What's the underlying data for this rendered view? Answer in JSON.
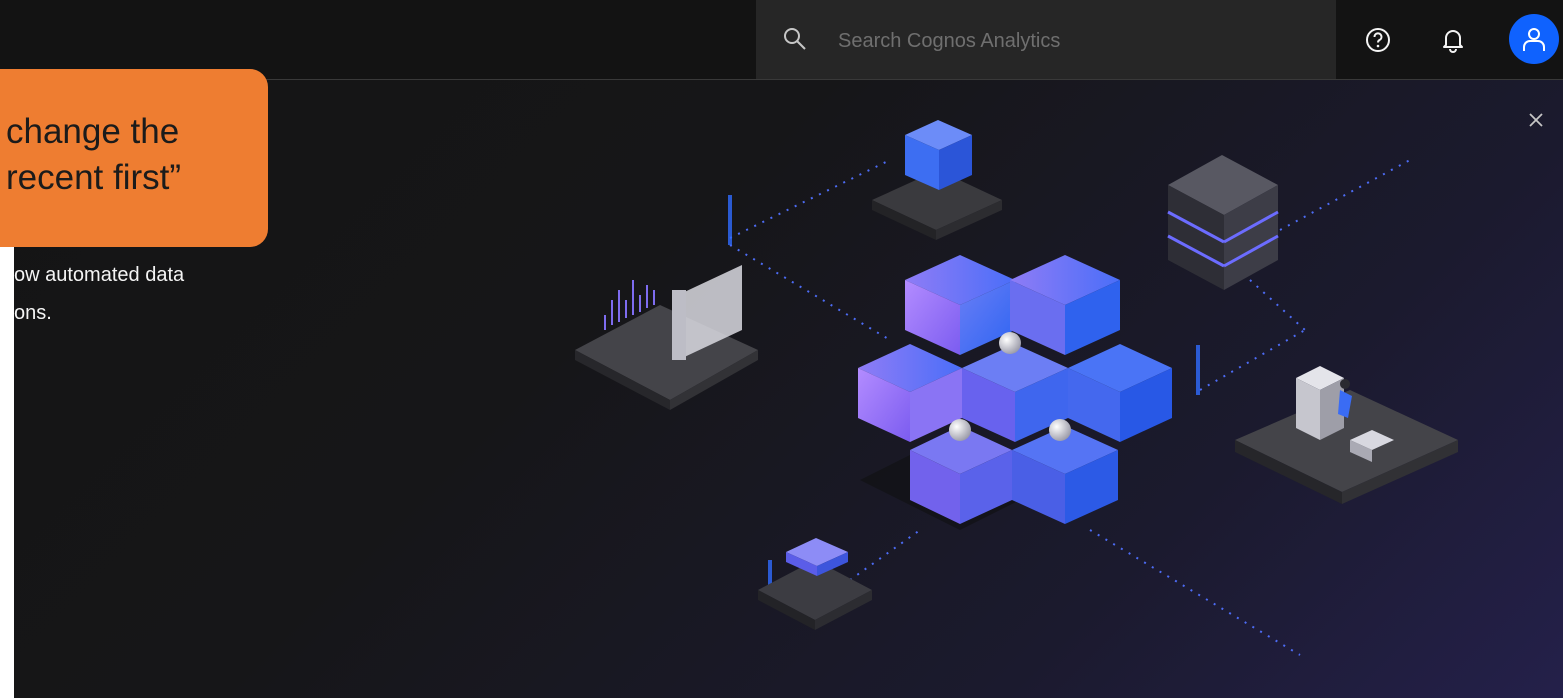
{
  "header": {
    "search": {
      "placeholder": "Search Cognos Analytics"
    },
    "icons": {
      "help": "help-icon",
      "notifications": "bell-icon",
      "user": "user-icon"
    },
    "accent_color": "#0f62fe"
  },
  "callout": {
    "line1": "change the",
    "line2": "recent first”",
    "color": "#ee7d31"
  },
  "panel": {
    "desc_line1": "ow automated data",
    "desc_line2": "ons.",
    "close_icon": "close-icon"
  }
}
